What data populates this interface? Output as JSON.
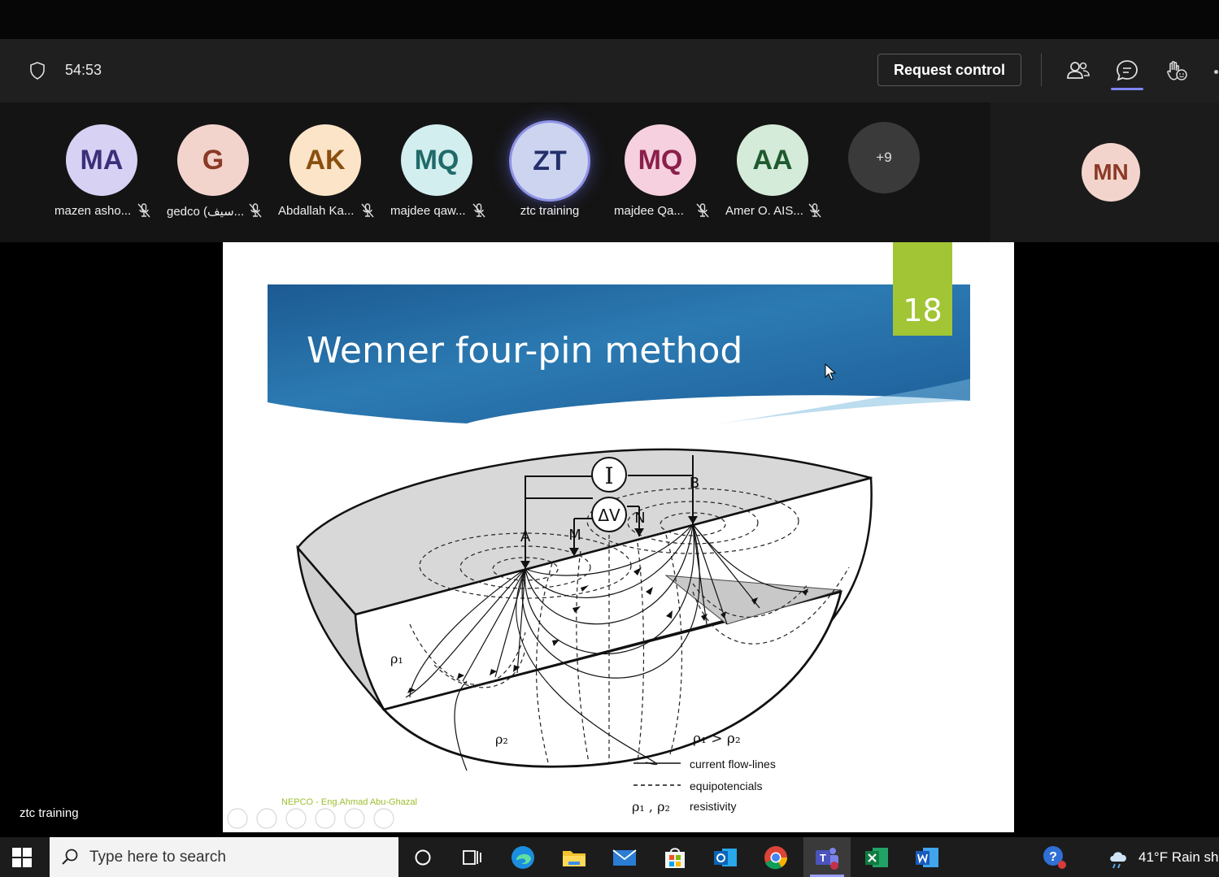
{
  "meeting": {
    "timer": "54:53",
    "request_control_label": "Request control"
  },
  "participants": [
    {
      "initials": "MA",
      "name": "mazen asho...",
      "muted": true,
      "bg": "#d7d2f3",
      "fg": "#3b2f7a"
    },
    {
      "initials": "G",
      "name": "gedco (سيف...",
      "muted": true,
      "bg": "#f3d4cc",
      "fg": "#8a3a26"
    },
    {
      "initials": "AK",
      "name": "Abdallah Ka...",
      "muted": true,
      "bg": "#fbe4c8",
      "fg": "#8a4f0e"
    },
    {
      "initials": "MQ",
      "name": "majdee qaw...",
      "muted": true,
      "bg": "#d3eeee",
      "fg": "#1f6a6a"
    },
    {
      "initials": "ZT",
      "name": "ztc training",
      "muted": false,
      "bg": "#cdd4f0",
      "fg": "#23306b"
    },
    {
      "initials": "MQ",
      "name": "majdee Qa...",
      "muted": true,
      "bg": "#f6d0de",
      "fg": "#8a1f4b"
    },
    {
      "initials": "AA",
      "name": "Amer O. AIS...",
      "muted": true,
      "bg": "#d4ebd9",
      "fg": "#1e5a2e"
    }
  ],
  "overflow": {
    "label": "+9"
  },
  "self": {
    "initials": "MN",
    "bg": "#f3d4cc",
    "fg": "#8a3a26"
  },
  "slide": {
    "title": "Wenner four-pin method",
    "number": "18",
    "labels": {
      "current_symbol": "I",
      "voltage_symbol": "ΔV",
      "pin_a": "A",
      "pin_m": "M",
      "pin_n": "N",
      "pin_b": "B",
      "rho1": "ρ₁",
      "rho2": "ρ₂",
      "rho_relation": "ρ₁ > ρ₂"
    },
    "legend": [
      {
        "symbol": "solid",
        "label": "current flow-lines"
      },
      {
        "symbol": "dashed",
        "label": "equipotencials"
      },
      {
        "symbol": "ρ₁ , ρ₂",
        "label": "resistivity"
      }
    ],
    "footer": "NEPCO - Eng.Ahmad Abu-Ghazal"
  },
  "stage_label": "ztc training",
  "taskbar": {
    "search_placeholder": "Type here to search",
    "weather": "41°F  Rain sh"
  }
}
